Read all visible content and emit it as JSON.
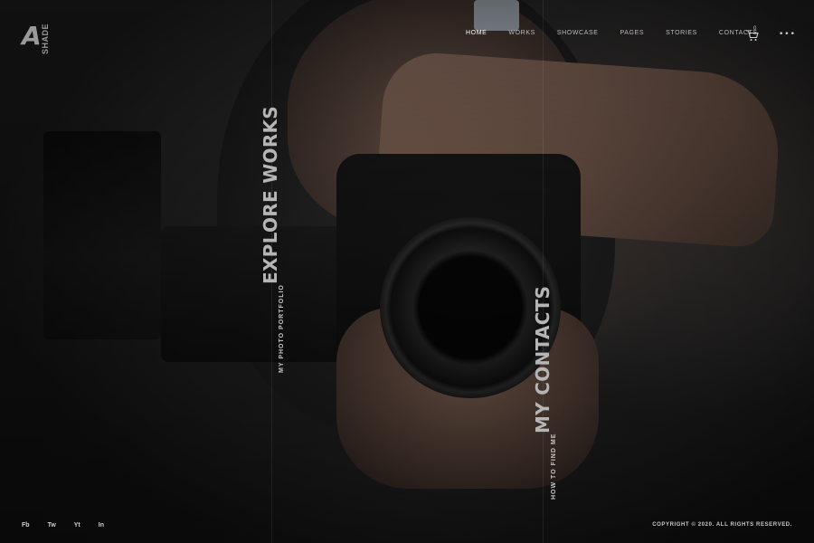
{
  "logo": {
    "mark": "A",
    "word": "SHADE"
  },
  "nav": {
    "items": [
      {
        "label": "HOME",
        "active": true
      },
      {
        "label": "WORKS",
        "active": false
      },
      {
        "label": "SHOWCASE",
        "active": false
      },
      {
        "label": "PAGES",
        "active": false
      },
      {
        "label": "STORIES",
        "active": false
      },
      {
        "label": "CONTACTS",
        "active": false
      }
    ],
    "cart_count": "0",
    "cart_icon": "cart-icon",
    "menu_icon": "more-dots-icon"
  },
  "panels": {
    "works": {
      "eyebrow": "MY PHOTO PORTFOLIO",
      "title": "EXPLORE WORKS"
    },
    "contacts": {
      "eyebrow": "HOW TO FIND ME",
      "title": "MY CONTACTS"
    }
  },
  "footer": {
    "socials": [
      "Fb",
      "Tw",
      "Yt",
      "In"
    ],
    "copyright": "COPYRIGHT © 2020. ALL RIGHTS RESERVED."
  },
  "colors": {
    "active_nav": "#ffffff",
    "nav": "#b9b9b9",
    "background": "#1a1a1a"
  }
}
